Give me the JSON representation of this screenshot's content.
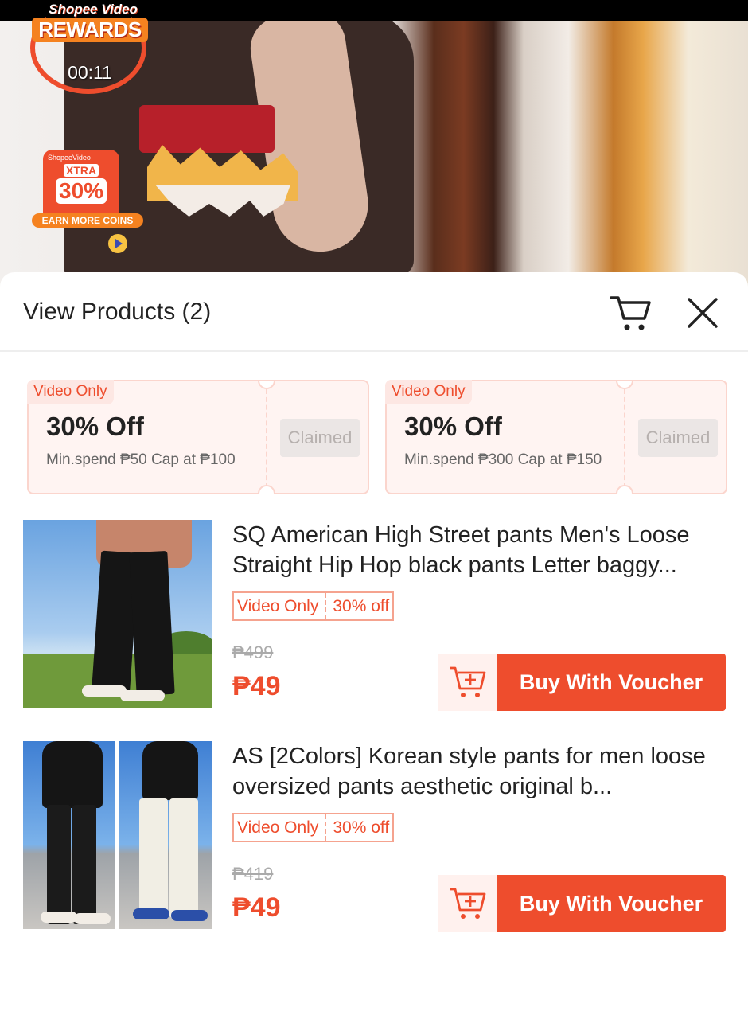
{
  "video": {
    "brand": "Shopee Video",
    "rewards_title": "REWARDS",
    "timer": "00:11",
    "promo_brand": "ShopeeVideo",
    "promo_xtra": "XTRA",
    "promo_pct": "30%",
    "promo_earn": "EARN MORE COINS"
  },
  "sheet": {
    "title": "View Products (2)"
  },
  "vouchers": [
    {
      "tag": "Video Only",
      "amount": "30% Off",
      "condition": "Min.spend ₱50 Cap at ₱100",
      "button": "Claimed"
    },
    {
      "tag": "Video Only",
      "amount": "30% Off",
      "condition": "Min.spend ₱300 Cap at ₱150",
      "button": "Claimed"
    }
  ],
  "products": [
    {
      "name": "SQ American High Street pants Men's Loose Straight Hip Hop black pants Letter baggy...",
      "badge_label": "Video Only",
      "badge_discount": "30% off",
      "old_price": "₱499",
      "price": "₱49",
      "buy_label": "Buy With Voucher"
    },
    {
      "name": "AS [2Colors] Korean style pants for men loose oversized pants aesthetic original b...",
      "badge_label": "Video Only",
      "badge_discount": "30% off",
      "old_price": "₱419",
      "price": "₱49",
      "buy_label": "Buy With Voucher"
    }
  ],
  "icons": {
    "cart": "cart-icon",
    "close": "close-icon",
    "add_to_cart": "add-to-cart-icon"
  },
  "colors": {
    "accent": "#ee4d2d",
    "voucher_bg": "#fff4f2",
    "claimed_bg": "#ebe6e5"
  }
}
